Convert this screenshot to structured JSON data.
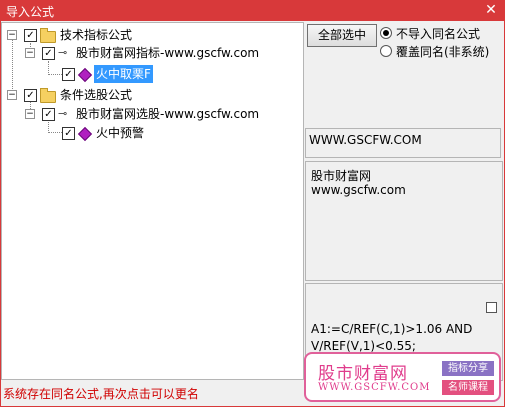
{
  "window": {
    "title": "导入公式",
    "close_glyph": "✕"
  },
  "tree": {
    "expand_glyph": "−",
    "check_glyph": "✓",
    "nodes": [
      {
        "label": "技术指标公式"
      },
      {
        "label": "股市财富网指标-www.gscfw.com"
      },
      {
        "label": "火中取栗F"
      },
      {
        "label": "条件选股公式"
      },
      {
        "label": "股市财富网选股-www.gscfw.com"
      },
      {
        "label": "火中预警"
      }
    ]
  },
  "options": {
    "select_all_label": "全部选中",
    "radio_no_import": "不导入同名公式",
    "radio_overwrite": "覆盖同名(非系统)"
  },
  "info": {
    "url": "WWW.GSCFW.COM",
    "site_name": "股市财富网",
    "site_url": "www.gscfw.com"
  },
  "formula": {
    "line1": "A1:=C/REF(C,1)>1.06 AND",
    "line2": "V/REF(V,1)<0.55;"
  },
  "status_text": "系统存在同名公式,再次点击可以更名",
  "watermark": {
    "name": "股市财富网",
    "url": "WWW.GSCFW.COM",
    "tag1": "指标分享",
    "tag2": "名师课程"
  }
}
